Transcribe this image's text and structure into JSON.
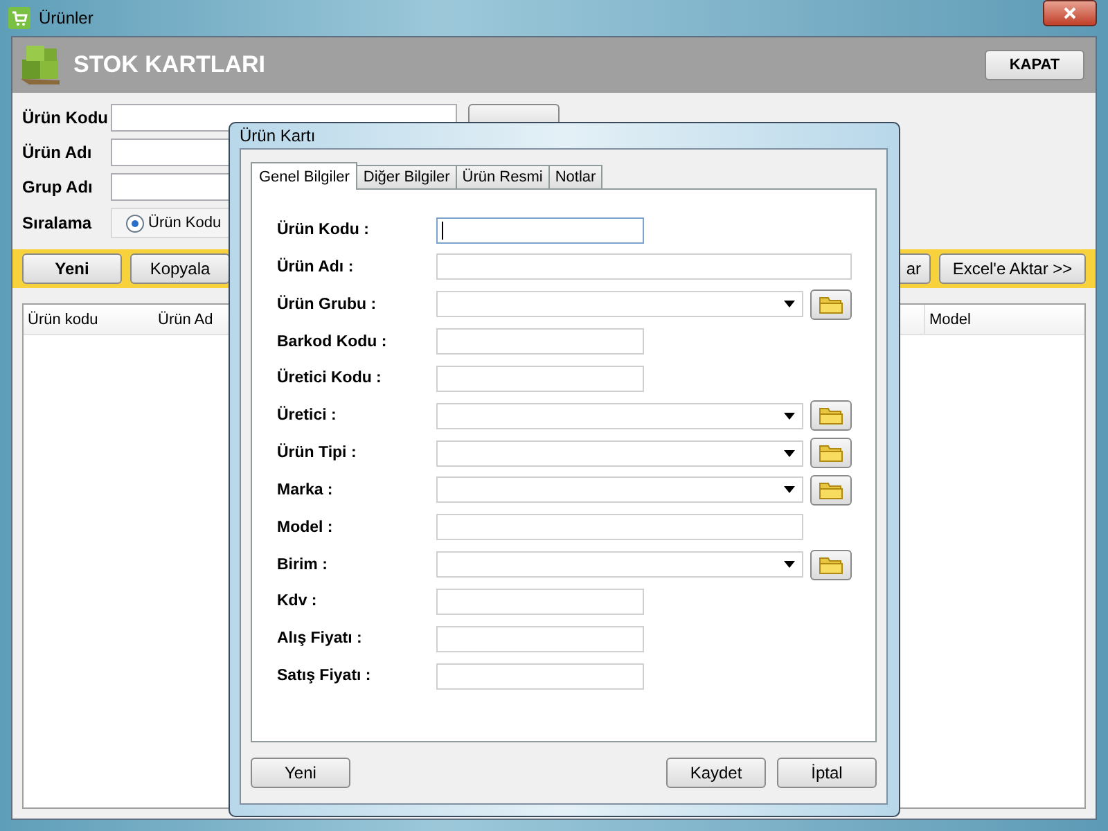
{
  "window": {
    "title": "Ürünler"
  },
  "header": {
    "title": "STOK KARTLARI",
    "close_button": "KAPAT"
  },
  "filters": [
    {
      "label": "Ürün Kodu"
    },
    {
      "label": "Ürün Adı"
    },
    {
      "label": "Grup Adı"
    }
  ],
  "sort": {
    "label": "Sıralama",
    "options": [
      {
        "label": "Ürün Kodu",
        "selected": true
      }
    ]
  },
  "toolbar": {
    "buttons": [
      {
        "label": "Yeni",
        "kind": "primary"
      },
      {
        "label": "Kopyala",
        "kind": "normal"
      }
    ],
    "right_buttons": [
      "ar",
      "Excel'e Aktar >>"
    ]
  },
  "table": {
    "columns": [
      "Ürün kodu",
      "Ürün Ad",
      "Model"
    ]
  },
  "dialog": {
    "title": "Ürün Kartı",
    "tabs": [
      {
        "label": "Genel Bilgiler",
        "selected": true
      },
      {
        "label": "Diğer Bilgiler",
        "selected": false
      },
      {
        "label": "Ürün Resmi",
        "selected": false
      },
      {
        "label": "Notlar",
        "selected": false
      }
    ],
    "fields": [
      {
        "label": "Ürün Kodu :",
        "kind": "short",
        "focused": true
      },
      {
        "label": "Ürün Adı :",
        "kind": "long",
        "focused": false
      },
      {
        "label": "Ürün Grubu :",
        "kind": "lookup",
        "focused": false
      },
      {
        "label": "Barkod Kodu :",
        "kind": "short",
        "focused": false
      },
      {
        "label": "Üretici Kodu :",
        "kind": "short",
        "focused": false
      },
      {
        "label": "Üretici :",
        "kind": "lookup",
        "focused": false
      },
      {
        "label": "Ürün Tipi :",
        "kind": "lookup",
        "focused": false
      },
      {
        "label": "Marka :",
        "kind": "lookup",
        "focused": false
      },
      {
        "label": "Model :",
        "kind": "medium",
        "focused": false
      },
      {
        "label": "Birim :",
        "kind": "lookup",
        "focused": false
      },
      {
        "label": "Kdv :",
        "kind": "short",
        "focused": false
      },
      {
        "label": "Alış Fiyatı :",
        "kind": "short",
        "focused": false
      },
      {
        "label": "Satış Fiyatı :",
        "kind": "short",
        "focused": false
      }
    ],
    "left_buttons": [
      "Yeni"
    ],
    "right_buttons": [
      "Kaydet",
      "İptal"
    ]
  }
}
